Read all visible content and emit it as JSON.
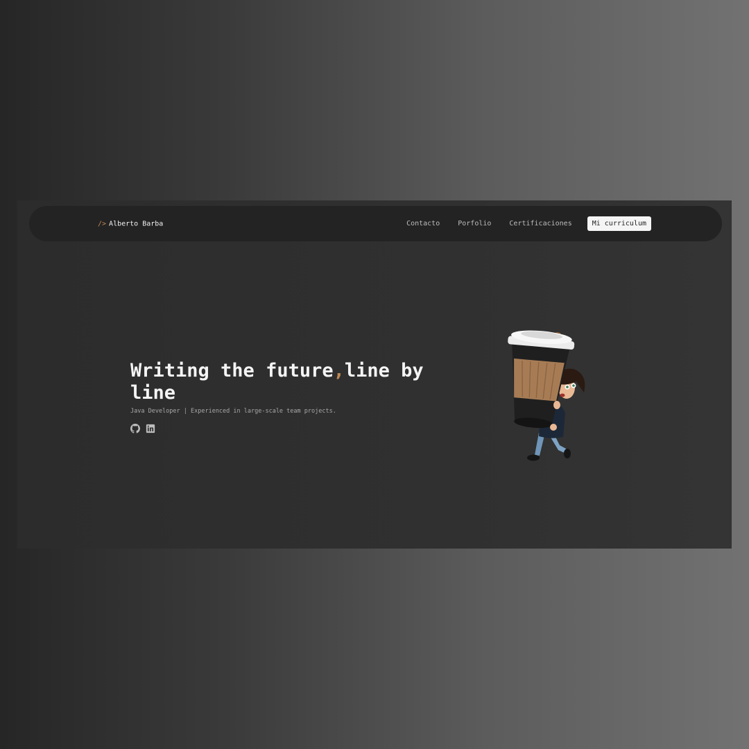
{
  "header": {
    "brand_prefix": "/>",
    "brand_name": "Alberto Barba"
  },
  "nav": {
    "items": [
      {
        "label": "Contacto"
      },
      {
        "label": "Porfolio"
      },
      {
        "label": "Certificaciones"
      }
    ],
    "cta_label": "Mi curriculum"
  },
  "hero": {
    "title_part1": "Writing the future",
    "title_comma": ",",
    "title_part2": "line by line",
    "subtitle": "Java Developer | Experienced in large-scale team projects."
  },
  "socials": [
    {
      "icon": "github-icon"
    },
    {
      "icon": "linkedin-icon"
    }
  ],
  "colors": {
    "accent": "#c08a55",
    "navbar_bg": "#232323",
    "page_bg": "#2e2e2e",
    "title_text": "#f4f4f4"
  }
}
